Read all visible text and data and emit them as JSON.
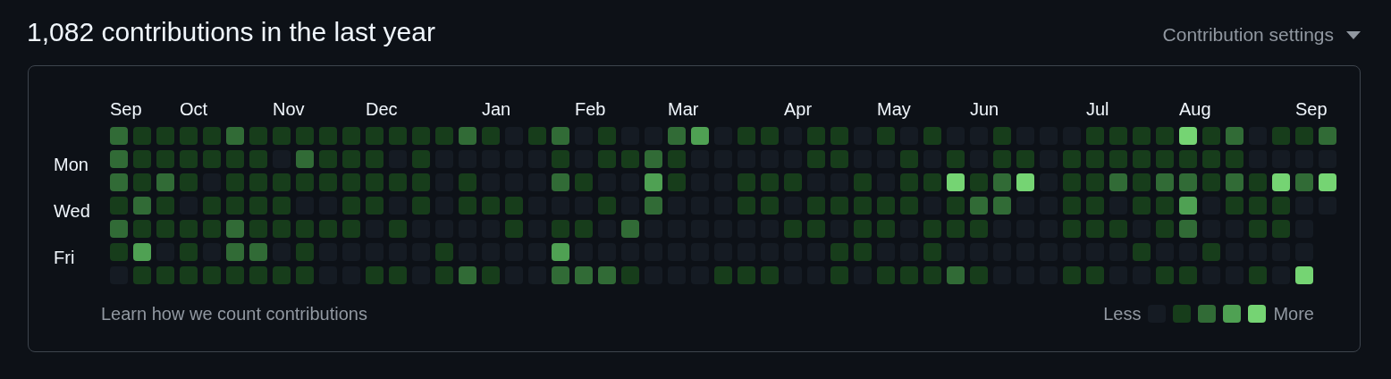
{
  "title": "1,082 contributions in the last year",
  "settings_menu": {
    "label": "Contribution settings"
  },
  "day_labels": [
    "Mon",
    "Wed",
    "Fri"
  ],
  "weeks": [
    {
      "month": "Sep",
      "days": [
        {
          "color": "#316b36"
        },
        {
          "color": "#316b36"
        },
        {
          "color": "#316b36"
        },
        {
          "color": "#173d1b"
        },
        {
          "color": "#316b36"
        },
        {
          "color": "#173d1b"
        },
        {
          "color": "#151b23"
        }
      ]
    },
    {
      "days": [
        {
          "color": "#173d1b"
        },
        {
          "color": "#173d1b"
        },
        {
          "color": "#173d1b"
        },
        {
          "color": "#316b36"
        },
        {
          "color": "#173d1b"
        },
        {
          "color": "#4fa153"
        },
        {
          "color": "#173d1b"
        }
      ]
    },
    {
      "days": [
        {
          "color": "#173d1b"
        },
        {
          "color": "#173d1b"
        },
        {
          "color": "#316b36"
        },
        {
          "color": "#173d1b"
        },
        {
          "color": "#173d1b"
        },
        {
          "color": "#151b23"
        },
        {
          "color": "#173d1b"
        }
      ]
    },
    {
      "month": "Oct",
      "days": [
        {
          "color": "#173d1b"
        },
        {
          "color": "#173d1b"
        },
        {
          "color": "#173d1b"
        },
        {
          "color": "#151b23"
        },
        {
          "color": "#173d1b"
        },
        {
          "color": "#173d1b"
        },
        {
          "color": "#173d1b"
        }
      ]
    },
    {
      "days": [
        {
          "color": "#173d1b"
        },
        {
          "color": "#173d1b"
        },
        {
          "color": "#151b23"
        },
        {
          "color": "#173d1b"
        },
        {
          "color": "#173d1b"
        },
        {
          "color": "#151b23"
        },
        {
          "color": "#173d1b"
        }
      ]
    },
    {
      "days": [
        {
          "color": "#316b36"
        },
        {
          "color": "#173d1b"
        },
        {
          "color": "#173d1b"
        },
        {
          "color": "#173d1b"
        },
        {
          "color": "#316b36"
        },
        {
          "color": "#316b36"
        },
        {
          "color": "#173d1b"
        }
      ]
    },
    {
      "days": [
        {
          "color": "#173d1b"
        },
        {
          "color": "#173d1b"
        },
        {
          "color": "#173d1b"
        },
        {
          "color": "#173d1b"
        },
        {
          "color": "#173d1b"
        },
        {
          "color": "#316b36"
        },
        {
          "color": "#173d1b"
        }
      ]
    },
    {
      "month": "Nov",
      "days": [
        {
          "color": "#173d1b"
        },
        {
          "color": "#151b23"
        },
        {
          "color": "#173d1b"
        },
        {
          "color": "#173d1b"
        },
        {
          "color": "#173d1b"
        },
        {
          "color": "#151b23"
        },
        {
          "color": "#173d1b"
        }
      ]
    },
    {
      "days": [
        {
          "color": "#173d1b"
        },
        {
          "color": "#316b36"
        },
        {
          "color": "#173d1b"
        },
        {
          "color": "#151b23"
        },
        {
          "color": "#173d1b"
        },
        {
          "color": "#173d1b"
        },
        {
          "color": "#173d1b"
        }
      ]
    },
    {
      "days": [
        {
          "color": "#173d1b"
        },
        {
          "color": "#173d1b"
        },
        {
          "color": "#173d1b"
        },
        {
          "color": "#151b23"
        },
        {
          "color": "#173d1b"
        },
        {
          "color": "#151b23"
        },
        {
          "color": "#151b23"
        }
      ]
    },
    {
      "days": [
        {
          "color": "#173d1b"
        },
        {
          "color": "#173d1b"
        },
        {
          "color": "#173d1b"
        },
        {
          "color": "#173d1b"
        },
        {
          "color": "#173d1b"
        },
        {
          "color": "#151b23"
        },
        {
          "color": "#151b23"
        }
      ]
    },
    {
      "month": "Dec",
      "days": [
        {
          "color": "#173d1b"
        },
        {
          "color": "#173d1b"
        },
        {
          "color": "#173d1b"
        },
        {
          "color": "#173d1b"
        },
        {
          "color": "#151b23"
        },
        {
          "color": "#151b23"
        },
        {
          "color": "#173d1b"
        }
      ]
    },
    {
      "days": [
        {
          "color": "#173d1b"
        },
        {
          "color": "#151b23"
        },
        {
          "color": "#173d1b"
        },
        {
          "color": "#151b23"
        },
        {
          "color": "#173d1b"
        },
        {
          "color": "#151b23"
        },
        {
          "color": "#173d1b"
        }
      ]
    },
    {
      "days": [
        {
          "color": "#173d1b"
        },
        {
          "color": "#173d1b"
        },
        {
          "color": "#173d1b"
        },
        {
          "color": "#173d1b"
        },
        {
          "color": "#151b23"
        },
        {
          "color": "#151b23"
        },
        {
          "color": "#151b23"
        }
      ]
    },
    {
      "days": [
        {
          "color": "#173d1b"
        },
        {
          "color": "#151b23"
        },
        {
          "color": "#151b23"
        },
        {
          "color": "#151b23"
        },
        {
          "color": "#151b23"
        },
        {
          "color": "#173d1b"
        },
        {
          "color": "#173d1b"
        }
      ]
    },
    {
      "days": [
        {
          "color": "#316b36"
        },
        {
          "color": "#151b23"
        },
        {
          "color": "#173d1b"
        },
        {
          "color": "#173d1b"
        },
        {
          "color": "#151b23"
        },
        {
          "color": "#151b23"
        },
        {
          "color": "#316b36"
        }
      ]
    },
    {
      "month": "Jan",
      "days": [
        {
          "color": "#173d1b"
        },
        {
          "color": "#151b23"
        },
        {
          "color": "#151b23"
        },
        {
          "color": "#173d1b"
        },
        {
          "color": "#151b23"
        },
        {
          "color": "#151b23"
        },
        {
          "color": "#173d1b"
        }
      ]
    },
    {
      "days": [
        {
          "color": "#151b23"
        },
        {
          "color": "#151b23"
        },
        {
          "color": "#151b23"
        },
        {
          "color": "#173d1b"
        },
        {
          "color": "#173d1b"
        },
        {
          "color": "#151b23"
        },
        {
          "color": "#151b23"
        }
      ]
    },
    {
      "days": [
        {
          "color": "#173d1b"
        },
        {
          "color": "#151b23"
        },
        {
          "color": "#151b23"
        },
        {
          "color": "#151b23"
        },
        {
          "color": "#151b23"
        },
        {
          "color": "#151b23"
        },
        {
          "color": "#151b23"
        }
      ]
    },
    {
      "days": [
        {
          "color": "#316b36"
        },
        {
          "color": "#173d1b"
        },
        {
          "color": "#316b36"
        },
        {
          "color": "#151b23"
        },
        {
          "color": "#173d1b"
        },
        {
          "color": "#4fa153"
        },
        {
          "color": "#316b36"
        }
      ]
    },
    {
      "month": "Feb",
      "days": [
        {
          "color": "#151b23"
        },
        {
          "color": "#151b23"
        },
        {
          "color": "#173d1b"
        },
        {
          "color": "#151b23"
        },
        {
          "color": "#173d1b"
        },
        {
          "color": "#151b23"
        },
        {
          "color": "#316b36"
        }
      ]
    },
    {
      "days": [
        {
          "color": "#173d1b"
        },
        {
          "color": "#173d1b"
        },
        {
          "color": "#151b23"
        },
        {
          "color": "#173d1b"
        },
        {
          "color": "#151b23"
        },
        {
          "color": "#151b23"
        },
        {
          "color": "#316b36"
        }
      ]
    },
    {
      "days": [
        {
          "color": "#151b23"
        },
        {
          "color": "#173d1b"
        },
        {
          "color": "#151b23"
        },
        {
          "color": "#151b23"
        },
        {
          "color": "#316b36"
        },
        {
          "color": "#151b23"
        },
        {
          "color": "#173d1b"
        }
      ]
    },
    {
      "days": [
        {
          "color": "#151b23"
        },
        {
          "color": "#316b36"
        },
        {
          "color": "#4fa153"
        },
        {
          "color": "#316b36"
        },
        {
          "color": "#151b23"
        },
        {
          "color": "#151b23"
        },
        {
          "color": "#151b23"
        }
      ]
    },
    {
      "month": "Mar",
      "days": [
        {
          "color": "#316b36"
        },
        {
          "color": "#173d1b"
        },
        {
          "color": "#173d1b"
        },
        {
          "color": "#151b23"
        },
        {
          "color": "#151b23"
        },
        {
          "color": "#151b23"
        },
        {
          "color": "#151b23"
        }
      ]
    },
    {
      "days": [
        {
          "color": "#4fa153"
        },
        {
          "color": "#151b23"
        },
        {
          "color": "#151b23"
        },
        {
          "color": "#151b23"
        },
        {
          "color": "#151b23"
        },
        {
          "color": "#151b23"
        },
        {
          "color": "#151b23"
        }
      ]
    },
    {
      "days": [
        {
          "color": "#151b23"
        },
        {
          "color": "#151b23"
        },
        {
          "color": "#151b23"
        },
        {
          "color": "#151b23"
        },
        {
          "color": "#151b23"
        },
        {
          "color": "#151b23"
        },
        {
          "color": "#173d1b"
        }
      ]
    },
    {
      "days": [
        {
          "color": "#173d1b"
        },
        {
          "color": "#151b23"
        },
        {
          "color": "#173d1b"
        },
        {
          "color": "#173d1b"
        },
        {
          "color": "#151b23"
        },
        {
          "color": "#151b23"
        },
        {
          "color": "#173d1b"
        }
      ]
    },
    {
      "days": [
        {
          "color": "#173d1b"
        },
        {
          "color": "#151b23"
        },
        {
          "color": "#173d1b"
        },
        {
          "color": "#173d1b"
        },
        {
          "color": "#151b23"
        },
        {
          "color": "#151b23"
        },
        {
          "color": "#173d1b"
        }
      ]
    },
    {
      "month": "Apr",
      "days": [
        {
          "color": "#151b23"
        },
        {
          "color": "#151b23"
        },
        {
          "color": "#173d1b"
        },
        {
          "color": "#151b23"
        },
        {
          "color": "#173d1b"
        },
        {
          "color": "#151b23"
        },
        {
          "color": "#151b23"
        }
      ]
    },
    {
      "days": [
        {
          "color": "#173d1b"
        },
        {
          "color": "#173d1b"
        },
        {
          "color": "#151b23"
        },
        {
          "color": "#173d1b"
        },
        {
          "color": "#173d1b"
        },
        {
          "color": "#151b23"
        },
        {
          "color": "#151b23"
        }
      ]
    },
    {
      "days": [
        {
          "color": "#173d1b"
        },
        {
          "color": "#173d1b"
        },
        {
          "color": "#151b23"
        },
        {
          "color": "#173d1b"
        },
        {
          "color": "#151b23"
        },
        {
          "color": "#173d1b"
        },
        {
          "color": "#173d1b"
        }
      ]
    },
    {
      "days": [
        {
          "color": "#151b23"
        },
        {
          "color": "#151b23"
        },
        {
          "color": "#173d1b"
        },
        {
          "color": "#173d1b"
        },
        {
          "color": "#173d1b"
        },
        {
          "color": "#173d1b"
        },
        {
          "color": "#151b23"
        }
      ]
    },
    {
      "month": "May",
      "days": [
        {
          "color": "#173d1b"
        },
        {
          "color": "#151b23"
        },
        {
          "color": "#151b23"
        },
        {
          "color": "#173d1b"
        },
        {
          "color": "#173d1b"
        },
        {
          "color": "#151b23"
        },
        {
          "color": "#173d1b"
        }
      ]
    },
    {
      "days": [
        {
          "color": "#151b23"
        },
        {
          "color": "#173d1b"
        },
        {
          "color": "#173d1b"
        },
        {
          "color": "#173d1b"
        },
        {
          "color": "#151b23"
        },
        {
          "color": "#151b23"
        },
        {
          "color": "#173d1b"
        }
      ]
    },
    {
      "days": [
        {
          "color": "#173d1b"
        },
        {
          "color": "#151b23"
        },
        {
          "color": "#173d1b"
        },
        {
          "color": "#151b23"
        },
        {
          "color": "#173d1b"
        },
        {
          "color": "#173d1b"
        },
        {
          "color": "#173d1b"
        }
      ]
    },
    {
      "days": [
        {
          "color": "#151b23"
        },
        {
          "color": "#173d1b"
        },
        {
          "color": "#75d473"
        },
        {
          "color": "#173d1b"
        },
        {
          "color": "#173d1b"
        },
        {
          "color": "#151b23"
        },
        {
          "color": "#316b36"
        }
      ]
    },
    {
      "month": "Jun",
      "days": [
        {
          "color": "#151b23"
        },
        {
          "color": "#151b23"
        },
        {
          "color": "#173d1b"
        },
        {
          "color": "#316b36"
        },
        {
          "color": "#173d1b"
        },
        {
          "color": "#151b23"
        },
        {
          "color": "#173d1b"
        }
      ]
    },
    {
      "days": [
        {
          "color": "#173d1b"
        },
        {
          "color": "#173d1b"
        },
        {
          "color": "#316b36"
        },
        {
          "color": "#316b36"
        },
        {
          "color": "#151b23"
        },
        {
          "color": "#151b23"
        },
        {
          "color": "#151b23"
        }
      ]
    },
    {
      "days": [
        {
          "color": "#151b23"
        },
        {
          "color": "#173d1b"
        },
        {
          "color": "#75d473"
        },
        {
          "color": "#151b23"
        },
        {
          "color": "#151b23"
        },
        {
          "color": "#151b23"
        },
        {
          "color": "#151b23"
        }
      ]
    },
    {
      "days": [
        {
          "color": "#151b23"
        },
        {
          "color": "#151b23"
        },
        {
          "color": "#151b23"
        },
        {
          "color": "#151b23"
        },
        {
          "color": "#151b23"
        },
        {
          "color": "#151b23"
        },
        {
          "color": "#151b23"
        }
      ]
    },
    {
      "days": [
        {
          "color": "#151b23"
        },
        {
          "color": "#173d1b"
        },
        {
          "color": "#173d1b"
        },
        {
          "color": "#173d1b"
        },
        {
          "color": "#173d1b"
        },
        {
          "color": "#151b23"
        },
        {
          "color": "#173d1b"
        }
      ]
    },
    {
      "month": "Jul",
      "days": [
        {
          "color": "#173d1b"
        },
        {
          "color": "#173d1b"
        },
        {
          "color": "#173d1b"
        },
        {
          "color": "#173d1b"
        },
        {
          "color": "#173d1b"
        },
        {
          "color": "#151b23"
        },
        {
          "color": "#173d1b"
        }
      ]
    },
    {
      "days": [
        {
          "color": "#173d1b"
        },
        {
          "color": "#173d1b"
        },
        {
          "color": "#316b36"
        },
        {
          "color": "#151b23"
        },
        {
          "color": "#173d1b"
        },
        {
          "color": "#151b23"
        },
        {
          "color": "#151b23"
        }
      ]
    },
    {
      "days": [
        {
          "color": "#173d1b"
        },
        {
          "color": "#173d1b"
        },
        {
          "color": "#173d1b"
        },
        {
          "color": "#173d1b"
        },
        {
          "color": "#151b23"
        },
        {
          "color": "#173d1b"
        },
        {
          "color": "#151b23"
        }
      ]
    },
    {
      "days": [
        {
          "color": "#173d1b"
        },
        {
          "color": "#173d1b"
        },
        {
          "color": "#316b36"
        },
        {
          "color": "#173d1b"
        },
        {
          "color": "#173d1b"
        },
        {
          "color": "#151b23"
        },
        {
          "color": "#173d1b"
        }
      ]
    },
    {
      "month": "Aug",
      "days": [
        {
          "color": "#75d473"
        },
        {
          "color": "#173d1b"
        },
        {
          "color": "#316b36"
        },
        {
          "color": "#4fa153"
        },
        {
          "color": "#316b36"
        },
        {
          "color": "#151b23"
        },
        {
          "color": "#173d1b"
        }
      ]
    },
    {
      "days": [
        {
          "color": "#173d1b"
        },
        {
          "color": "#173d1b"
        },
        {
          "color": "#173d1b"
        },
        {
          "color": "#151b23"
        },
        {
          "color": "#151b23"
        },
        {
          "color": "#173d1b"
        },
        {
          "color": "#151b23"
        }
      ]
    },
    {
      "days": [
        {
          "color": "#316b36"
        },
        {
          "color": "#173d1b"
        },
        {
          "color": "#316b36"
        },
        {
          "color": "#173d1b"
        },
        {
          "color": "#151b23"
        },
        {
          "color": "#151b23"
        },
        {
          "color": "#151b23"
        }
      ]
    },
    {
      "days": [
        {
          "color": "#151b23"
        },
        {
          "color": "#151b23"
        },
        {
          "color": "#173d1b"
        },
        {
          "color": "#173d1b"
        },
        {
          "color": "#173d1b"
        },
        {
          "color": "#151b23"
        },
        {
          "color": "#173d1b"
        }
      ]
    },
    {
      "days": [
        {
          "color": "#173d1b"
        },
        {
          "color": "#151b23"
        },
        {
          "color": "#75d473"
        },
        {
          "color": "#173d1b"
        },
        {
          "color": "#173d1b"
        },
        {
          "color": "#151b23"
        },
        {
          "color": "#151b23"
        }
      ]
    },
    {
      "month": "Sep",
      "days": [
        {
          "color": "#173d1b"
        },
        {
          "color": "#151b23"
        },
        {
          "color": "#316b36"
        },
        {
          "color": "#151b23"
        },
        {
          "color": "#151b23"
        },
        {
          "color": "#151b23"
        },
        {
          "color": "#75d473"
        }
      ]
    },
    {
      "days": [
        {
          "color": "#316b36"
        },
        {
          "color": "#151b23"
        },
        {
          "color": "#75d473"
        },
        {
          "color": "#151b23"
        }
      ]
    }
  ],
  "footer_link": "Learn how we count contributions",
  "legend": {
    "less": "Less",
    "more": "More",
    "swatches": [
      {
        "color": "#151b23"
      },
      {
        "color": "#173d1b"
      },
      {
        "color": "#316b36"
      },
      {
        "color": "#4fa153"
      },
      {
        "color": "#75d473"
      }
    ]
  }
}
